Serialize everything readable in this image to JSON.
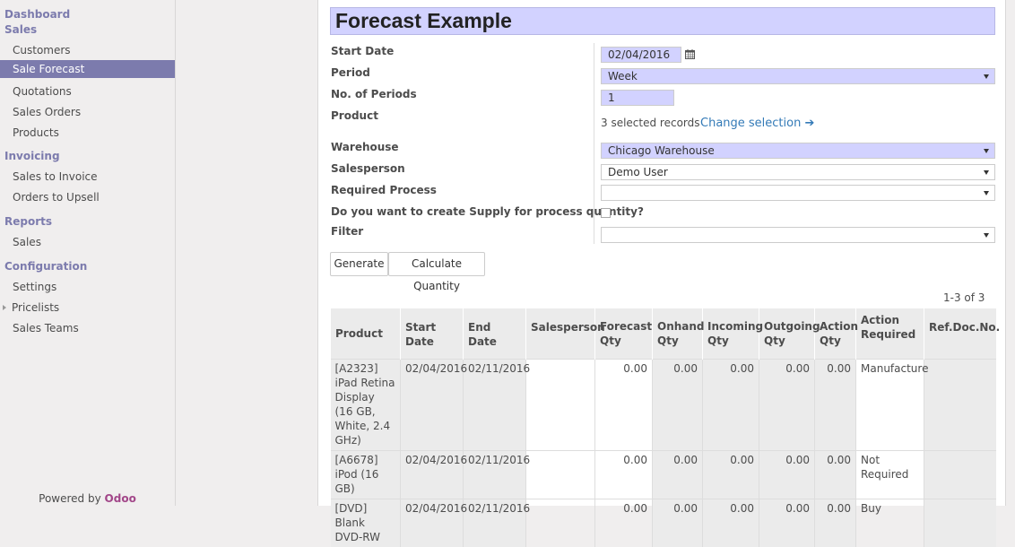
{
  "sidebar": {
    "dashboard": "Dashboard",
    "sales_section": "Sales",
    "sales_items": [
      "Customers",
      "Sale Forecast",
      "Quotations",
      "Sales Orders",
      "Products"
    ],
    "invoicing_section": "Invoicing",
    "invoicing_items": [
      "Sales to Invoice",
      "Orders to Upsell"
    ],
    "reports_section": "Reports",
    "reports_items": [
      "Sales"
    ],
    "configuration_section": "Configuration",
    "configuration_items": [
      "Settings",
      "Pricelists",
      "Sales Teams"
    ],
    "powered_by": "Powered by",
    "brand": "Odoo"
  },
  "form": {
    "title": "Forecast Example",
    "labels": {
      "start_date": "Start Date",
      "period": "Period",
      "num_periods": "No. of Periods",
      "product": "Product",
      "warehouse": "Warehouse",
      "salesperson": "Salesperson",
      "required_process": "Required Process",
      "supply_question": "Do you want to create Supply for process quantity?",
      "filter": "Filter"
    },
    "values": {
      "start_date": "02/04/2016",
      "period": "Week",
      "num_periods": "1",
      "product_selected": "3 selected records",
      "change_selection": "Change selection",
      "warehouse": "Chicago Warehouse",
      "salesperson": "Demo User",
      "required_process": "",
      "filter": ""
    },
    "buttons": {
      "generate": "Generate",
      "calculate_quantity": "Calculate Quantity"
    }
  },
  "pager": "1-3 of 3",
  "table": {
    "headers": {
      "product": "Product",
      "start_date": "Start Date",
      "end_date": "End Date",
      "salesperson": "Salesperson",
      "forecast_qty": "Forecast Qty",
      "onhand_qty": "Onhand Qty",
      "incoming_qty": "Incoming Qty",
      "outgoing_qty": "Outgoing Qty",
      "action_qty": "Action Qty",
      "action_required": "Action Required",
      "ref_doc_no": "Ref.Doc.No."
    },
    "rows": [
      {
        "product": "[A2323] iPad Retina Display (16 GB, White, 2.4 GHz)",
        "start_date": "02/04/2016",
        "end_date": "02/11/2016",
        "salesperson": "",
        "forecast_qty": "0.00",
        "onhand_qty": "0.00",
        "incoming_qty": "0.00",
        "outgoing_qty": "0.00",
        "action_qty": "0.00",
        "action_required": "Manufacture",
        "ref_doc_no": ""
      },
      {
        "product": "[A6678] iPod (16 GB)",
        "start_date": "02/04/2016",
        "end_date": "02/11/2016",
        "salesperson": "",
        "forecast_qty": "0.00",
        "onhand_qty": "0.00",
        "incoming_qty": "0.00",
        "outgoing_qty": "0.00",
        "action_qty": "0.00",
        "action_required": "Not Required",
        "ref_doc_no": ""
      },
      {
        "product": "[DVD] Blank DVD-RW",
        "start_date": "02/04/2016",
        "end_date": "02/11/2016",
        "salesperson": "",
        "forecast_qty": "0.00",
        "onhand_qty": "0.00",
        "incoming_qty": "0.00",
        "outgoing_qty": "0.00",
        "action_qty": "0.00",
        "action_required": "Buy",
        "ref_doc_no": ""
      }
    ]
  }
}
